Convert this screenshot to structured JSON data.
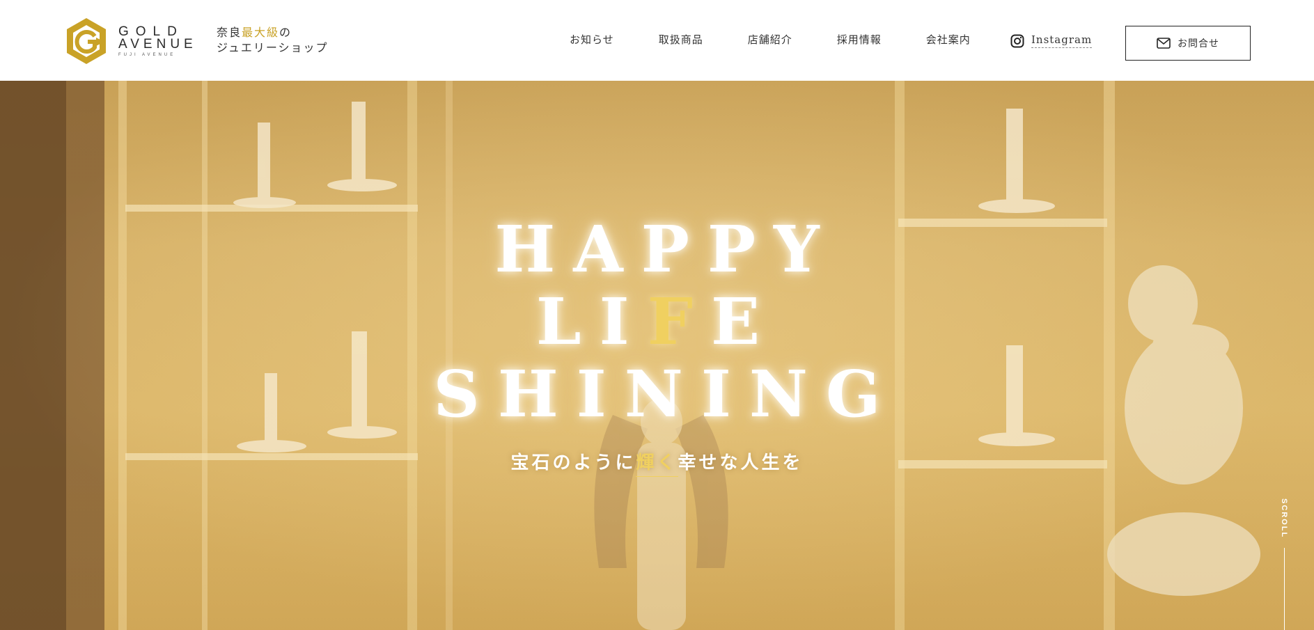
{
  "brand": {
    "name_line1": "GOLD",
    "name_line2": "AVENUE",
    "name_sub": "FUJI AVENUE",
    "logo_icon": "hexagon-g-icon"
  },
  "tagline": {
    "part1": "奈良",
    "part_highlight": "最大級",
    "part2": "の",
    "line2": "ジュエリーショップ"
  },
  "nav": {
    "items": [
      {
        "label": "お知らせ"
      },
      {
        "label": "取扱商品"
      },
      {
        "label": "店舗紹介"
      },
      {
        "label": "採用情報"
      },
      {
        "label": "会社案内"
      }
    ],
    "instagram_label": "Instagram",
    "contact_label": "お問合せ"
  },
  "hero": {
    "line1": "HAPPY",
    "line2_pre": "LI",
    "line2_gold": "F",
    "line2_post": "E",
    "line3": "SHINING",
    "sub_pre": "宝石のように",
    "sub_accent": "輝く",
    "sub_post": "幸せな人生を",
    "scroll_label": "SCROLL"
  },
  "colors": {
    "accent_gold": "#c9a227",
    "hero_gold": "#f0d060",
    "text_dark": "#333333"
  }
}
